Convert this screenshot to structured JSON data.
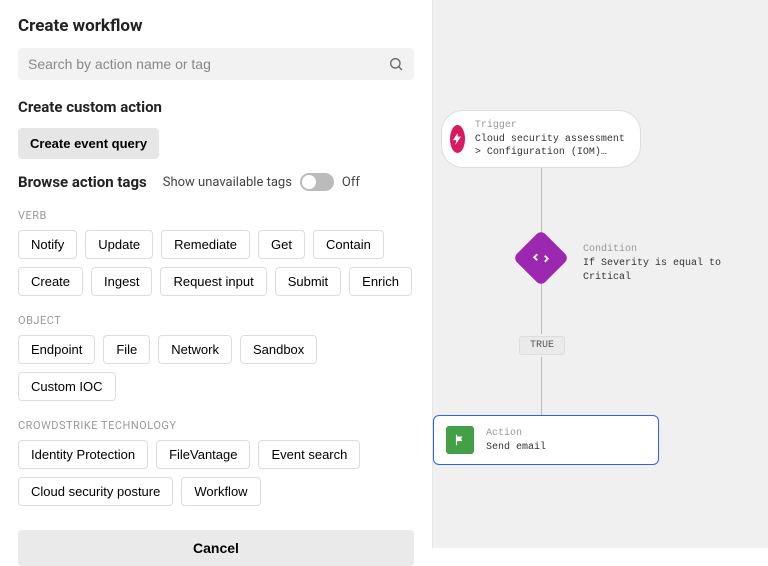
{
  "header": {
    "title": "Create workflow"
  },
  "search": {
    "placeholder": "Search by action name or tag"
  },
  "custom_action": {
    "title": "Create custom action",
    "button": "Create event query"
  },
  "browse": {
    "title": "Browse action tags",
    "toggle_label": "Show unavailable tags",
    "toggle_state": "Off"
  },
  "tag_groups": {
    "verb": {
      "label": "VERB",
      "tags": [
        "Notify",
        "Update",
        "Remediate",
        "Get",
        "Contain",
        "Create",
        "Ingest",
        "Request input",
        "Submit",
        "Enrich"
      ]
    },
    "object": {
      "label": "OBJECT",
      "tags": [
        "Endpoint",
        "File",
        "Network",
        "Sandbox",
        "Custom IOC"
      ]
    },
    "tech": {
      "label": "CROWDSTRIKE TECHNOLOGY",
      "tags": [
        "Identity Protection",
        "FileVantage",
        "Event search",
        "Cloud security posture",
        "Workflow"
      ]
    }
  },
  "footer": {
    "cancel": "Cancel"
  },
  "canvas": {
    "trigger": {
      "type_label": "Trigger",
      "text": "Cloud security assessment > Configuration (IOM)…"
    },
    "condition": {
      "type_label": "Condition",
      "text": "If Severity is equal to Critical"
    },
    "branch_label": "TRUE",
    "action": {
      "type_label": "Action",
      "text": "Send email"
    }
  }
}
